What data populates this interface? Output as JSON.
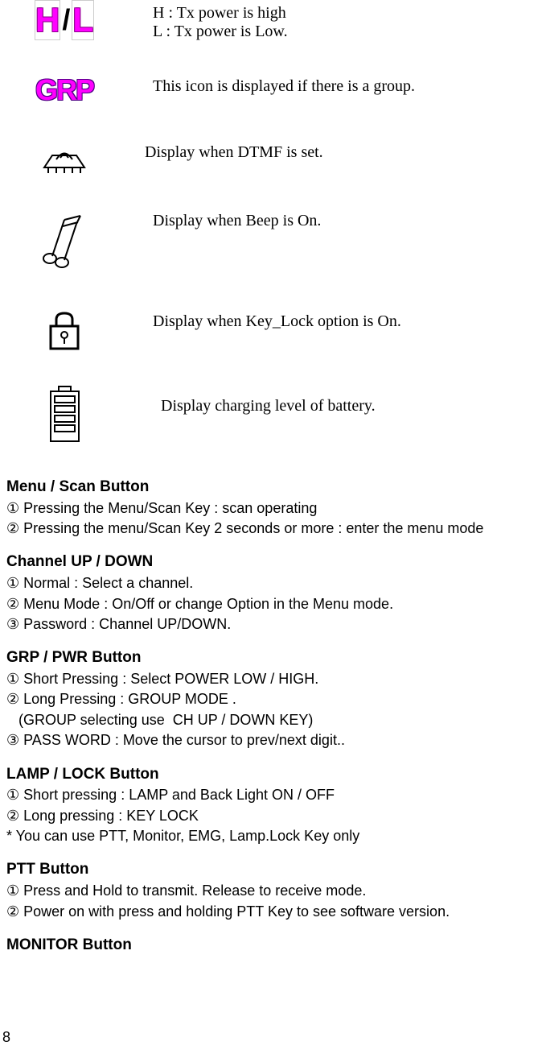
{
  "icons": {
    "hl": {
      "line1": "H : Tx power is high",
      "line2": "L : Tx power is Low."
    },
    "grp": "This icon is displayed if there is a group.",
    "dtmf": "Display when DTMF is set.",
    "beep": "Display when Beep is On.",
    "lock": "Display when Key_Lock option is On.",
    "battery": "Display charging level of battery."
  },
  "sections": {
    "menu": {
      "title": "Menu / Scan  Button",
      "line1": "①  Pressing the Menu/Scan Key : scan operating",
      "line2": "②  Pressing the menu/Scan Key 2 seconds or more : enter the menu mode"
    },
    "channel": {
      "title": "Channel  UP / DOWN",
      "line1": "① Normal : Select a channel.",
      "line2": "② Menu Mode : On/Off  or  change Option  in the Menu mode.",
      "line3": "③ Password : Channel UP/DOWN."
    },
    "grp_pwr": {
      "title": "GRP / PWR  Button",
      "line1": "① Short Pressing : Select POWER LOW / HIGH.",
      "line2": "② Long Pressing : GROUP MODE .",
      "line3": "   (GROUP selecting use  CH UP / DOWN KEY)",
      "line4": "③ PASS WORD : Move the cursor to prev/next digit.."
    },
    "lamp": {
      "title": "LAMP / LOCK Button",
      "line1": "① Short pressing : LAMP and Back Light ON / OFF",
      "line2": "② Long pressing : KEY LOCK",
      "line3": " *  You can use PTT, Monitor, EMG, Lamp.Lock Key only"
    },
    "ptt": {
      "title": "PTT Button",
      "line1": "① Press and Hold to transmit. Release to receive mode.",
      "line2": "② Power on with press and holding PTT Key to see software version."
    },
    "monitor": {
      "title": "MONITOR Button"
    }
  },
  "page_number": "8"
}
